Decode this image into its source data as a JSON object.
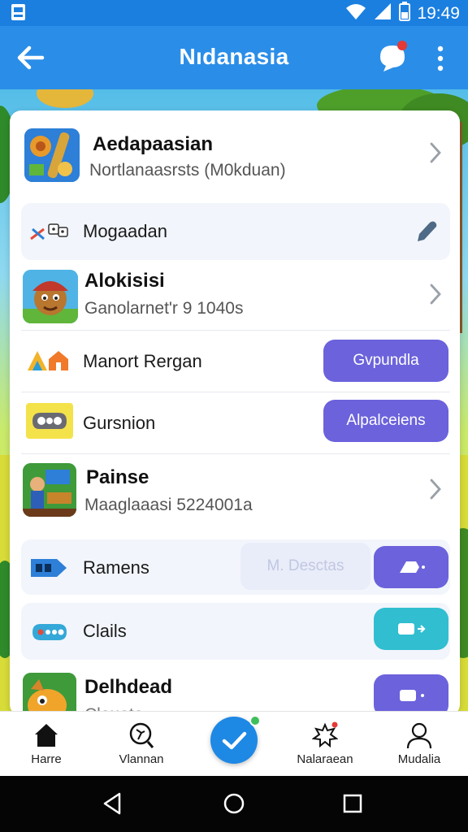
{
  "status_bar": {
    "time": "19:49",
    "icons": [
      "sim-card-icon",
      "wifi-icon",
      "signal-icon",
      "battery-icon"
    ]
  },
  "app_bar": {
    "title": "Nıdanasia",
    "back_icon": "arrow-left-icon",
    "bell_icon": "chat-bell-icon",
    "more_icon": "more-vert-icon"
  },
  "colors": {
    "app_bar": "#2a8ee8",
    "accent_purple": "#6b62dc",
    "accent_teal": "#30bed0",
    "fab": "#1e88e5"
  },
  "list": {
    "items": [
      {
        "title": "Aedapaasian",
        "subtitle": "Nortlanaasrsts (M0kduan)",
        "icon": "game-thumb-icon",
        "action": "chevron-right-icon"
      },
      {
        "label": "Mogaadan",
        "icon": "dice-icon",
        "action": "edit-pencil-icon"
      },
      {
        "title": "Alokisisi",
        "subtitle": "Ganolarnet'r 9 1040s",
        "icon": "character-thumb-icon",
        "action": "chevron-right-icon"
      },
      {
        "label": "Manort Rergan",
        "icon": "shapes-icon",
        "button": "Gvpundla"
      },
      {
        "label": "Gursnion",
        "icon": "gamepad-icon",
        "button": "Alpalceiens"
      },
      {
        "title": "Painse",
        "subtitle": "Maaglaaasi 5224001a",
        "icon": "scene-thumb-icon",
        "action": "chevron-right-icon"
      },
      {
        "label": "Ramens",
        "icon": "tag-icon",
        "ghost": "M. Desctas",
        "button_icon": "send-icon"
      },
      {
        "label": "Clails",
        "icon": "controller-icon",
        "button_icon": "toggle-forward-icon"
      },
      {
        "title": "Delhdead",
        "subtitle": "Clouoto",
        "icon": "creature-thumb-icon",
        "button_icon": "toggle-dot-icon"
      }
    ]
  },
  "bottom_nav": {
    "items": [
      {
        "label": "Harre",
        "icon": "home-icon"
      },
      {
        "label": "Vlannan",
        "icon": "search-runner-icon"
      },
      {
        "label": "",
        "icon": "check-icon"
      },
      {
        "label": "Nalaraean",
        "icon": "notification-star-icon"
      },
      {
        "label": "Mudalia",
        "icon": "profile-icon"
      }
    ]
  },
  "system_nav": {
    "icons": [
      "back-triangle-icon",
      "home-circle-icon",
      "recents-square-icon"
    ]
  }
}
